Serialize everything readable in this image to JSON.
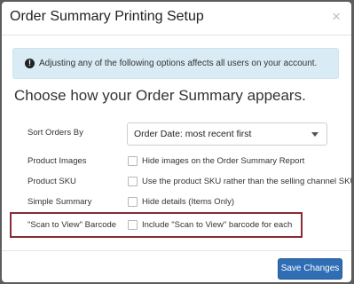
{
  "dialog": {
    "title": "Order Summary Printing Setup",
    "close_symbol": "×"
  },
  "alert": {
    "icon": "exclamation-circle-icon",
    "icon_symbol": "!",
    "text": "Adjusting any of the following options affects all users on your account."
  },
  "heading": "Choose how your Order Summary appears.",
  "sort": {
    "label": "Sort Orders By",
    "selected": "Order Date: most recent first"
  },
  "options": {
    "product_images": {
      "label": "Product Images",
      "text": "Hide images on the Order Summary Report",
      "checked": false
    },
    "product_sku": {
      "label": "Product SKU",
      "text": "Use the product SKU rather than the selling channel SKU",
      "checked": false
    },
    "simple_summary": {
      "label": "Simple Summary",
      "text": "Hide details (Items Only)",
      "checked": false
    },
    "scan_to_view": {
      "label": "\"Scan to View\" Barcode",
      "text": "Include \"Scan to View\" barcode for each",
      "checked": false
    }
  },
  "footer": {
    "save_label": "Save Changes"
  },
  "colors": {
    "accent_button": "#2f6db5",
    "alert_background": "#d9ecf5",
    "highlight_border": "#8a2b35"
  }
}
